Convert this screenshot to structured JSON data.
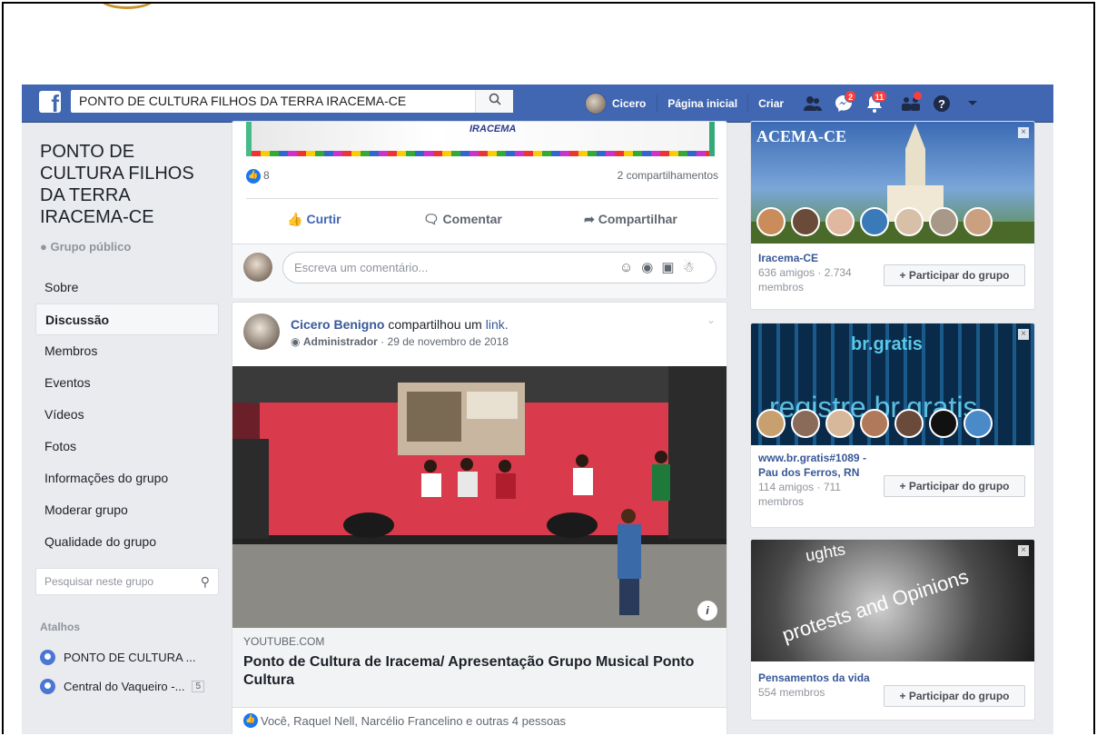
{
  "topbar": {
    "search_value": "PONTO DE CULTURA FILHOS DA TERRA  IRACEMA-CE",
    "user_name": "Cicero",
    "home_label": "Página inicial",
    "create_label": "Criar",
    "messages_badge": "2",
    "notifications_badge": "11"
  },
  "sidebar": {
    "group_name": "PONTO DE CULTURA FILHOS DA TERRA IRACEMA-CE",
    "group_type": "Grupo público",
    "items": [
      {
        "label": "Sobre"
      },
      {
        "label": "Discussão"
      },
      {
        "label": "Membros"
      },
      {
        "label": "Eventos"
      },
      {
        "label": "Vídeos"
      },
      {
        "label": "Fotos"
      },
      {
        "label": "Informações do grupo"
      },
      {
        "label": "Moderar grupo"
      },
      {
        "label": "Qualidade do grupo"
      }
    ],
    "search_placeholder": "Pesquisar neste grupo",
    "shortcuts_title": "Atalhos",
    "shortcuts": [
      {
        "label": "PONTO DE CULTURA ...",
        "count": ""
      },
      {
        "label": "Central do Vaqueiro -...",
        "count": "5"
      }
    ]
  },
  "post1": {
    "like_count": "8",
    "shares": "2 compartilhamentos",
    "like_label": "Curtir",
    "comment_label": "Comentar",
    "share_label": "Compartilhar",
    "comment_placeholder": "Escreva um comentário...",
    "banner_text": "IRACEMA"
  },
  "post2": {
    "author": "Cicero Benigno",
    "action": "compartilhou um",
    "link_word": "link.",
    "role": "Administrador",
    "date": "29 de novembro de 2018",
    "domain": "YOUTUBE.COM",
    "title": "Ponto de Cultura de Iracema/ Apresentação Grupo Musical Ponto Cultura",
    "reactions": "Você, Raquel Nell, Narcélio Francelino e outras 4 pessoas"
  },
  "suggestions": [
    {
      "image_text": "ACEMA-CE",
      "name": "Iracema-CE",
      "stats": "636 amigos · 2.734 membros",
      "button": "+ Participar do grupo"
    },
    {
      "image_text": "registre.br.gratis",
      "name": "www.br.gratis#1089 - Pau dos Ferros, RN",
      "stats": "114 amigos · 711 membros",
      "button": "+ Participar do grupo"
    },
    {
      "image_text": "protests and Opinions",
      "name": "Pensamentos da vida",
      "stats": "554 membros",
      "button": "+ Participar do grupo"
    }
  ]
}
